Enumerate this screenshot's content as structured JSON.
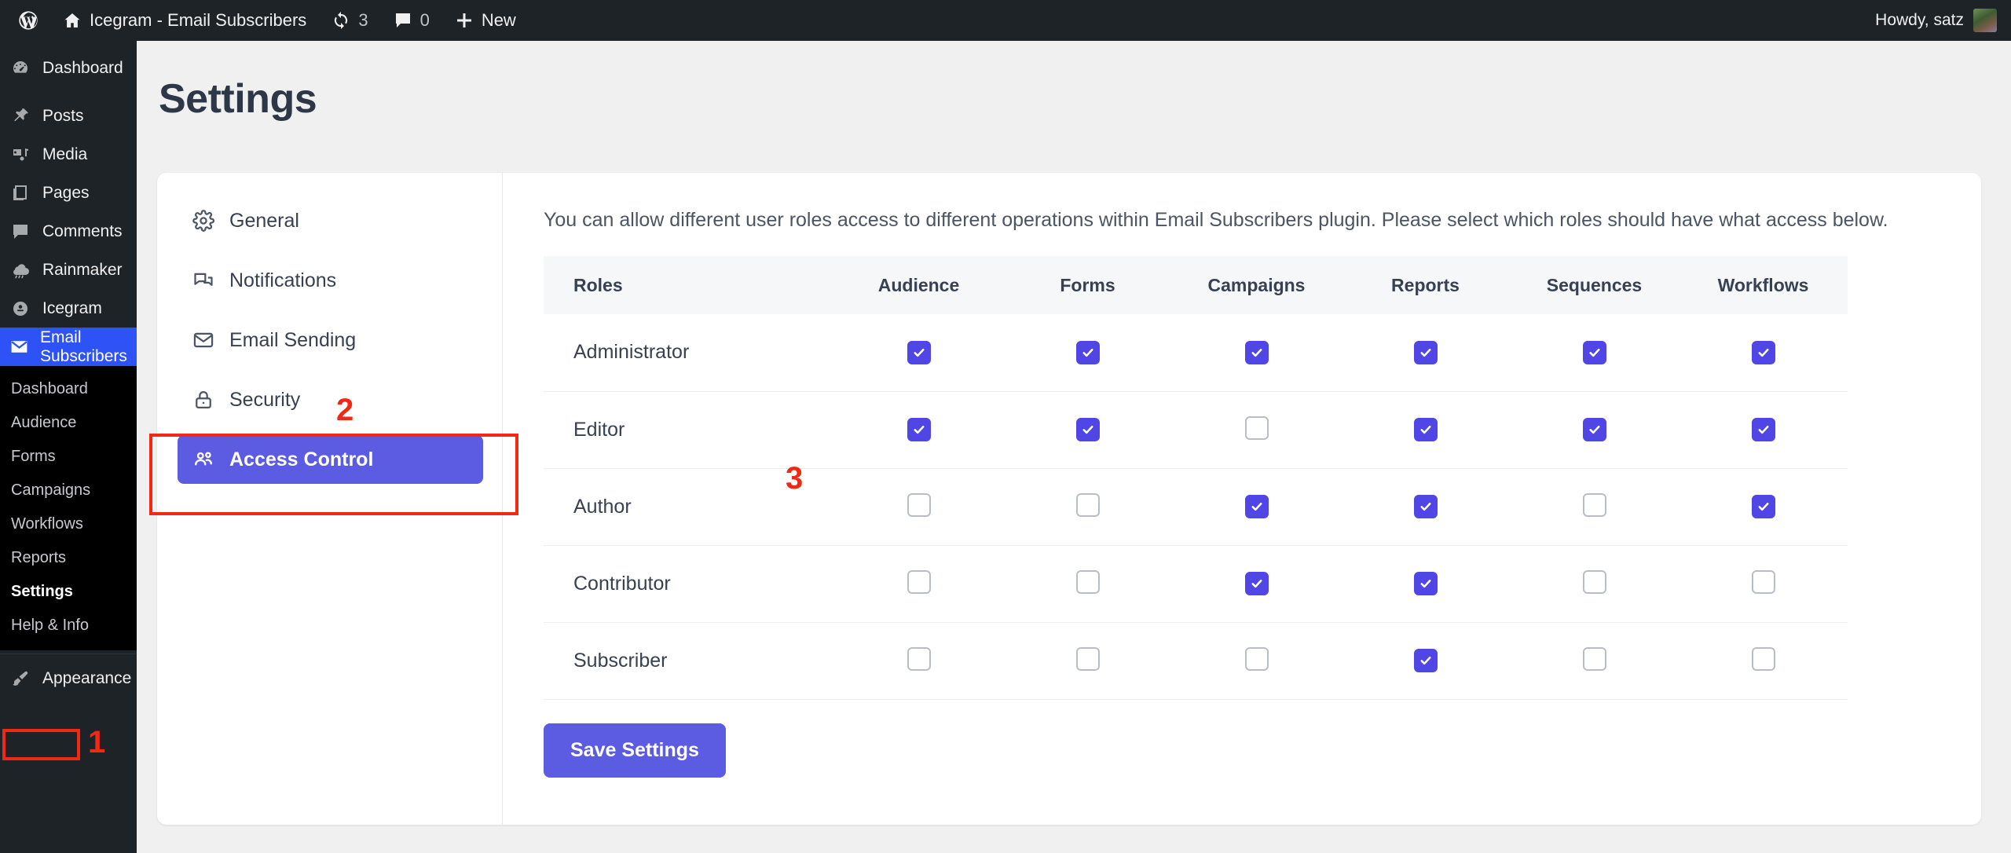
{
  "adminbar": {
    "wp_logo_icon": "wordpress-logo-icon",
    "site_home_icon": "home-icon",
    "site_name": "Icegram - Email Subscribers",
    "updates_icon": "updates-icon",
    "updates_count": "3",
    "comments_icon": "comment-bubble-icon",
    "comments_count": "0",
    "new_icon": "plus-icon",
    "new_label": "New",
    "howdy": "Howdy, satz",
    "avatar_icon": "avatar"
  },
  "sidebar": {
    "items": [
      {
        "label": "Dashboard",
        "icon": "dashboard-icon"
      },
      {
        "label": "Posts",
        "icon": "pin-icon"
      },
      {
        "label": "Media",
        "icon": "media-icon"
      },
      {
        "label": "Pages",
        "icon": "pages-icon"
      },
      {
        "label": "Comments",
        "icon": "comment-bubble-icon"
      },
      {
        "label": "Rainmaker",
        "icon": "cloud-rain-icon"
      },
      {
        "label": "Icegram",
        "icon": "user-circle-icon"
      },
      {
        "label": "Email Subscribers",
        "icon": "envelope-icon"
      }
    ],
    "current_item": "Email Subscribers",
    "submenu": [
      {
        "label": "Dashboard"
      },
      {
        "label": "Audience"
      },
      {
        "label": "Forms"
      },
      {
        "label": "Campaigns"
      },
      {
        "label": "Workflows"
      },
      {
        "label": "Reports"
      },
      {
        "label": "Settings"
      },
      {
        "label": "Help & Info"
      }
    ],
    "marked_submenu": "Settings",
    "bottom_items": [
      {
        "label": "Appearance",
        "icon": "brush-icon"
      }
    ]
  },
  "annotations": {
    "step1": "1",
    "step2": "2",
    "step3": "3",
    "color": "#f02814"
  },
  "page": {
    "title": "Settings"
  },
  "settings_nav": {
    "items": [
      {
        "label": "General",
        "icon": "gear-icon",
        "active": false
      },
      {
        "label": "Notifications",
        "icon": "chat-icon",
        "active": false
      },
      {
        "label": "Email Sending",
        "icon": "envelope-icon",
        "active": false
      },
      {
        "label": "Security",
        "icon": "lock-icon",
        "active": false
      },
      {
        "label": "Access Control",
        "icon": "users-group-icon",
        "active": true
      }
    ]
  },
  "access_control": {
    "description": "You can allow different user roles access to different operations within Email Subscribers plugin. Please select which roles should have what access below.",
    "columns": [
      "Roles",
      "Audience",
      "Forms",
      "Campaigns",
      "Reports",
      "Sequences",
      "Workflows"
    ],
    "rows": [
      {
        "role": "Administrator",
        "permissions": [
          true,
          true,
          true,
          true,
          true,
          true
        ]
      },
      {
        "role": "Editor",
        "permissions": [
          true,
          true,
          false,
          true,
          true,
          true
        ]
      },
      {
        "role": "Author",
        "permissions": [
          false,
          false,
          true,
          true,
          false,
          true
        ]
      },
      {
        "role": "Contributor",
        "permissions": [
          false,
          false,
          true,
          true,
          false,
          false
        ]
      },
      {
        "role": "Subscriber",
        "permissions": [
          false,
          false,
          false,
          true,
          false,
          false
        ]
      }
    ],
    "save_label": "Save Settings",
    "accent_color": "#5b5ce2",
    "checkbox_checked_color": "#4f46e5"
  }
}
